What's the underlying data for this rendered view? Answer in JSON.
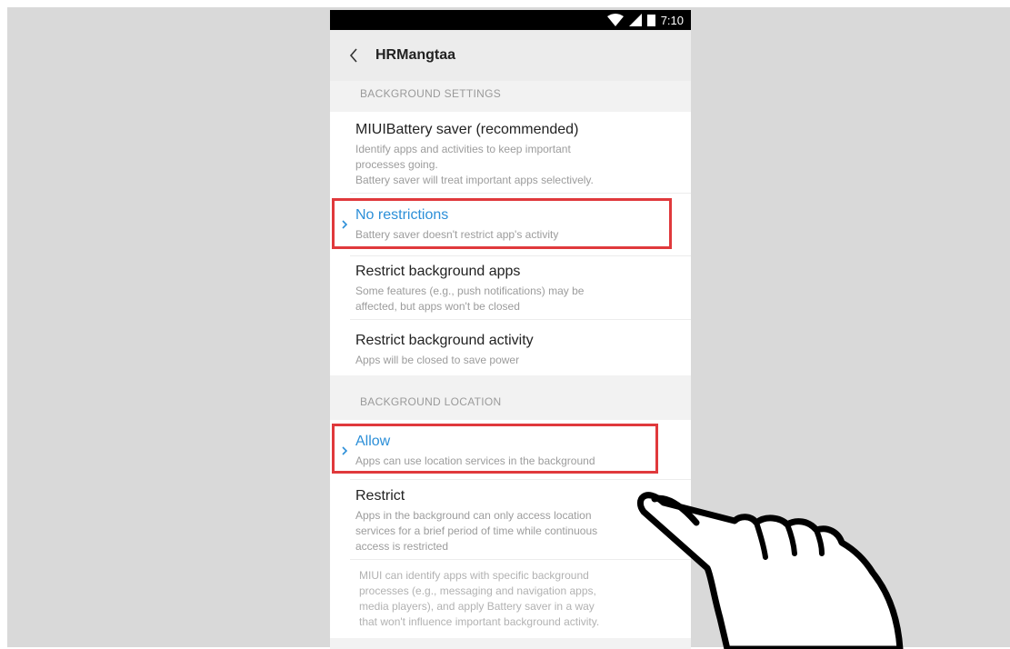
{
  "status_bar": {
    "time": "7:10"
  },
  "app_bar": {
    "title": "HRMangtaa"
  },
  "sections": {
    "background_settings": {
      "header": "BACKGROUND SETTINGS",
      "items": [
        {
          "title": "MIUIBattery saver (recommended)",
          "description_lines": [
            "Identify apps and activities to keep important",
            "processes going.",
            "Battery saver will treat important apps selectively."
          ]
        },
        {
          "title": "No restrictions",
          "description_lines": [
            "Battery saver doesn't restrict app's activity"
          ],
          "selected": true
        },
        {
          "title": "Restrict background apps",
          "description_lines": [
            "Some features (e.g., push notifications) may be",
            "affected, but apps won't be closed"
          ]
        },
        {
          "title": "Restrict background activity",
          "description_lines": [
            "Apps will be closed to save power"
          ]
        }
      ]
    },
    "background_location": {
      "header": "BACKGROUND LOCATION",
      "items": [
        {
          "title": "Allow",
          "description_lines": [
            "Apps can use location services in the background"
          ],
          "selected": true
        },
        {
          "title": "Restrict",
          "description_lines": [
            "Apps in the background can only access location",
            "services for a brief period of time while continuous",
            "access is restricted"
          ]
        }
      ],
      "footer_lines": [
        "MIUI can identify apps with specific background",
        "processes (e.g., messaging and navigation apps,",
        "media players), and apply Battery saver in a way",
        "that won't influence important background activity."
      ]
    }
  },
  "colors": {
    "accent": "#2c8fd8",
    "highlight": "#e0393c",
    "background": "#d9d9d9"
  },
  "icons": {
    "back": "chevron-left-icon",
    "wifi": "wifi-icon",
    "signal": "signal-icon",
    "battery": "battery-icon",
    "selected": "chevron-right-icon",
    "pointer": "pointing-hand-icon"
  }
}
